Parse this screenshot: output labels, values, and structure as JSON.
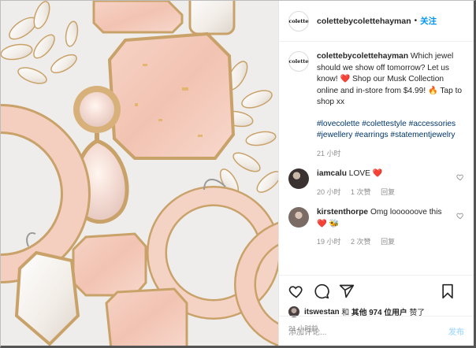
{
  "header": {
    "avatar_text": "colette",
    "username": "colettebycolettehayman",
    "separator": "•",
    "follow_label": "关注"
  },
  "caption": {
    "username": "colettebycolettehayman",
    "text": "Which jewel should we show off tomorrow? Let us know! ❤️ Shop our Musk Collection online and in-store from $4.99! 🔥 Tap to shop xx",
    "hashtags": "#lovecolette #colettestyle #accessories #jewellery #earrings #statementjewelry",
    "time": "21 小时"
  },
  "comments": [
    {
      "username": "iamcalu",
      "text": "LOVE ❤️",
      "time": "20 小时",
      "replies": "回复"
    },
    {
      "username": "kirstenthorpe",
      "text": "Omg loooooove this ❤️ 🐝",
      "time": "19 小时",
      "likes": "2 次赞",
      "replies": "回复"
    }
  ],
  "comment0_likes": "1 次赞",
  "likes_line": {
    "user": "itswestan",
    "and": "和",
    "others": "其他 974 位用户",
    "suffix": "赞了"
  },
  "post_time": "21 小时前",
  "add_comment": {
    "placeholder": "添加评论...",
    "post_label": "发布"
  }
}
